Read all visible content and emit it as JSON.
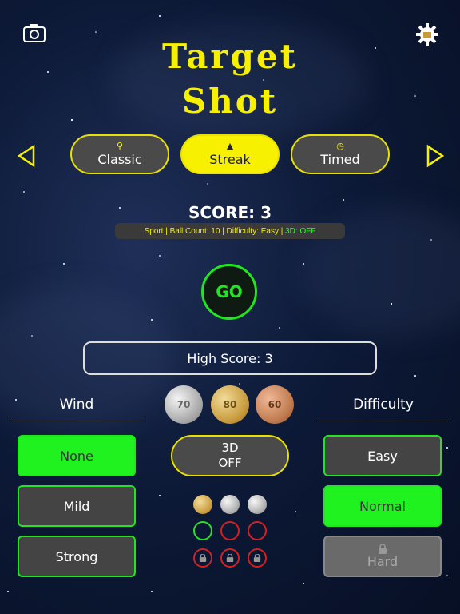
{
  "title": {
    "line1": "Target",
    "line2": "Shot"
  },
  "icons": {
    "camera": "camera-icon",
    "settings": "gear-icon",
    "prev": "triangle-left-icon",
    "next": "triangle-right-icon"
  },
  "modes": [
    {
      "label": "Classic",
      "icon": "shuttlecock-icon",
      "active": false
    },
    {
      "label": "Streak",
      "icon": "flame-icon",
      "active": true
    },
    {
      "label": "Timed",
      "icon": "stopwatch-icon",
      "active": false
    }
  ],
  "score": {
    "label": "SCORE: 3"
  },
  "info": {
    "text": "Sport | Ball Count: 10 | Difficulty: Easy | ",
    "threeD": "3D: OFF"
  },
  "go": {
    "label": "GO"
  },
  "high_score": {
    "label": "High Score: 3"
  },
  "wind": {
    "heading": "Wind",
    "options": [
      "None",
      "Mild",
      "Strong"
    ],
    "selected": "None"
  },
  "difficulty": {
    "heading": "Difficulty",
    "options": [
      "Easy",
      "Normal",
      "Hard"
    ],
    "selected": "Normal",
    "locked": "Hard"
  },
  "medals": [
    {
      "value": "70",
      "type": "silver"
    },
    {
      "value": "80",
      "type": "gold"
    },
    {
      "value": "60",
      "type": "bronze"
    }
  ],
  "toggle3d": {
    "line1": "3D",
    "line2": "OFF"
  },
  "colors": {
    "accent": "#f7f000",
    "green": "#22e522",
    "red": "#d42020"
  }
}
